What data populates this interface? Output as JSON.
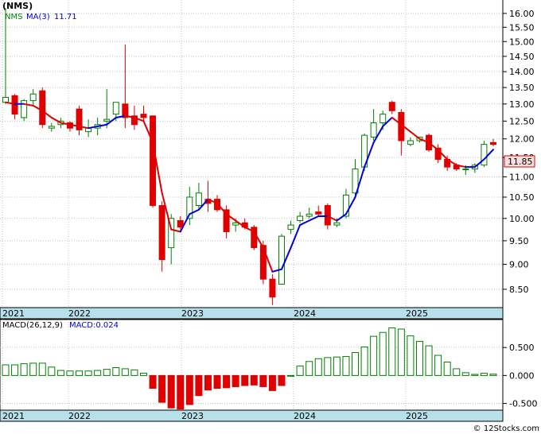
{
  "header": {
    "ticker_label": "(NMS)",
    "legend_symbol": "NMS",
    "legend_ma": "MA(3)",
    "legend_ma_value": "11.71",
    "macd_label": "MACD(26,12,9)",
    "macd_value_label": "MACD:0.024",
    "last_price_tag": "11.85",
    "watermark": "© 12Stocks.com"
  },
  "colors": {
    "up": "#008000",
    "down": "#e00000",
    "ma_up": "#0000dd",
    "ma_down": "#e00000",
    "axis_band": "#b8e0ea",
    "grid": "#c0c0c0"
  },
  "chart_data": [
    {
      "type": "candlestick",
      "title": "(NMS)",
      "ylim": [
        8.15,
        16.5
      ],
      "yscale": "log",
      "yticks": [
        "16.00",
        "15.50",
        "15.00",
        "14.50",
        "14.00",
        "13.50",
        "13.00",
        "12.50",
        "12.00",
        "11.50",
        "11.00",
        "10.50",
        "10.00",
        "9.50",
        "9.00",
        "8.50"
      ],
      "x_labels": [
        "2021",
        "2022",
        "2023",
        "2024",
        "2025"
      ],
      "grid": true,
      "series": [
        {
          "name": "NMS",
          "ohlc": [
            [
              13.05,
              16.2,
              13.0,
              13.2
            ],
            [
              13.25,
              13.3,
              12.55,
              12.7
            ],
            [
              12.6,
              13.15,
              12.5,
              13.1
            ],
            [
              13.1,
              13.45,
              12.95,
              13.3
            ],
            [
              13.4,
              13.5,
              12.3,
              12.4
            ],
            [
              12.3,
              12.45,
              12.2,
              12.35
            ],
            [
              12.4,
              12.6,
              12.3,
              12.5
            ],
            [
              12.45,
              12.5,
              12.2,
              12.3
            ],
            [
              12.85,
              12.95,
              12.1,
              12.25
            ],
            [
              12.2,
              12.55,
              12.05,
              12.3
            ],
            [
              12.3,
              12.6,
              12.1,
              12.4
            ],
            [
              12.5,
              13.45,
              12.3,
              12.55
            ],
            [
              12.7,
              13.05,
              12.5,
              13.05
            ],
            [
              13.0,
              14.9,
              12.3,
              12.6
            ],
            [
              12.65,
              12.95,
              12.25,
              12.4
            ],
            [
              12.7,
              12.95,
              12.5,
              12.6
            ],
            [
              12.65,
              12.65,
              10.25,
              10.3
            ],
            [
              10.3,
              10.4,
              8.85,
              9.1
            ],
            [
              9.35,
              10.1,
              9.0,
              10.0
            ],
            [
              9.95,
              10.05,
              9.75,
              9.8
            ],
            [
              10.0,
              10.75,
              9.85,
              10.5
            ],
            [
              10.3,
              10.85,
              10.2,
              10.6
            ],
            [
              10.45,
              10.9,
              10.15,
              10.35
            ],
            [
              10.45,
              10.55,
              10.15,
              10.2
            ],
            [
              10.2,
              10.3,
              9.55,
              9.7
            ],
            [
              9.85,
              10.0,
              9.7,
              9.9
            ],
            [
              9.9,
              10.0,
              9.75,
              9.8
            ],
            [
              9.8,
              9.85,
              9.3,
              9.35
            ],
            [
              9.4,
              9.5,
              8.6,
              8.7
            ],
            [
              8.7,
              8.8,
              8.2,
              8.35
            ],
            [
              8.6,
              9.65,
              8.6,
              9.6
            ],
            [
              9.75,
              9.95,
              9.65,
              9.85
            ],
            [
              9.95,
              10.15,
              9.9,
              10.05
            ],
            [
              10.05,
              10.25,
              10.0,
              10.1
            ],
            [
              10.15,
              10.3,
              10.05,
              10.1
            ],
            [
              10.3,
              10.35,
              9.75,
              9.85
            ],
            [
              9.85,
              10.0,
              9.8,
              9.9
            ],
            [
              10.05,
              10.7,
              10.0,
              10.55
            ],
            [
              10.6,
              11.45,
              10.5,
              11.2
            ],
            [
              11.25,
              12.15,
              11.15,
              12.1
            ],
            [
              12.05,
              12.85,
              11.95,
              12.45
            ],
            [
              12.45,
              12.8,
              12.25,
              12.7
            ],
            [
              13.05,
              13.1,
              12.7,
              12.8
            ],
            [
              12.75,
              12.85,
              11.55,
              11.95
            ],
            [
              11.85,
              12.05,
              11.8,
              11.95
            ],
            [
              11.95,
              12.05,
              11.9,
              12.05
            ],
            [
              12.1,
              12.15,
              11.65,
              11.7
            ],
            [
              11.75,
              11.85,
              11.35,
              11.45
            ],
            [
              11.45,
              11.55,
              11.15,
              11.25
            ],
            [
              11.3,
              11.35,
              11.15,
              11.2
            ],
            [
              11.2,
              11.3,
              11.05,
              11.2
            ],
            [
              11.2,
              11.35,
              11.1,
              11.3
            ],
            [
              11.3,
              11.95,
              11.25,
              11.85
            ],
            [
              11.9,
              12.0,
              11.8,
              11.85
            ]
          ]
        },
        {
          "name": "MA(3)",
          "values": [
            13.05,
            13.0,
            13.0,
            12.95,
            12.8,
            12.6,
            12.45,
            12.4,
            12.35,
            12.3,
            12.35,
            12.4,
            12.6,
            12.65,
            12.6,
            12.5,
            11.9,
            10.6,
            9.75,
            9.7,
            10.1,
            10.2,
            10.45,
            10.35,
            10.1,
            9.95,
            9.8,
            9.7,
            9.35,
            8.85,
            8.9,
            9.35,
            9.85,
            9.95,
            10.05,
            10.05,
            9.95,
            10.1,
            10.5,
            11.25,
            11.9,
            12.35,
            12.6,
            12.4,
            12.2,
            12.0,
            11.9,
            11.7,
            11.45,
            11.3,
            11.25,
            11.25,
            11.45,
            11.71
          ]
        }
      ]
    },
    {
      "type": "bar",
      "title": "MACD(26,12,9)",
      "ylim": [
        -0.62,
        1.0
      ],
      "yticks": [
        "0.500",
        "0.000",
        "-0.500"
      ],
      "x_labels": [
        "2021",
        "2022",
        "2023",
        "2024",
        "2025"
      ],
      "series": [
        {
          "name": "MACD",
          "values": [
            0.19,
            0.19,
            0.21,
            0.22,
            0.22,
            0.15,
            0.09,
            0.08,
            0.08,
            0.08,
            0.09,
            0.11,
            0.14,
            0.12,
            0.1,
            0.04,
            -0.23,
            -0.48,
            -0.58,
            -0.6,
            -0.52,
            -0.36,
            -0.26,
            -0.23,
            -0.22,
            -0.2,
            -0.18,
            -0.17,
            -0.2,
            -0.27,
            -0.18,
            0.0,
            0.17,
            0.25,
            0.3,
            0.32,
            0.33,
            0.34,
            0.41,
            0.51,
            0.7,
            0.77,
            0.85,
            0.83,
            0.71,
            0.61,
            0.53,
            0.36,
            0.24,
            0.12,
            0.05,
            0.02,
            0.04,
            0.024
          ]
        }
      ]
    }
  ]
}
